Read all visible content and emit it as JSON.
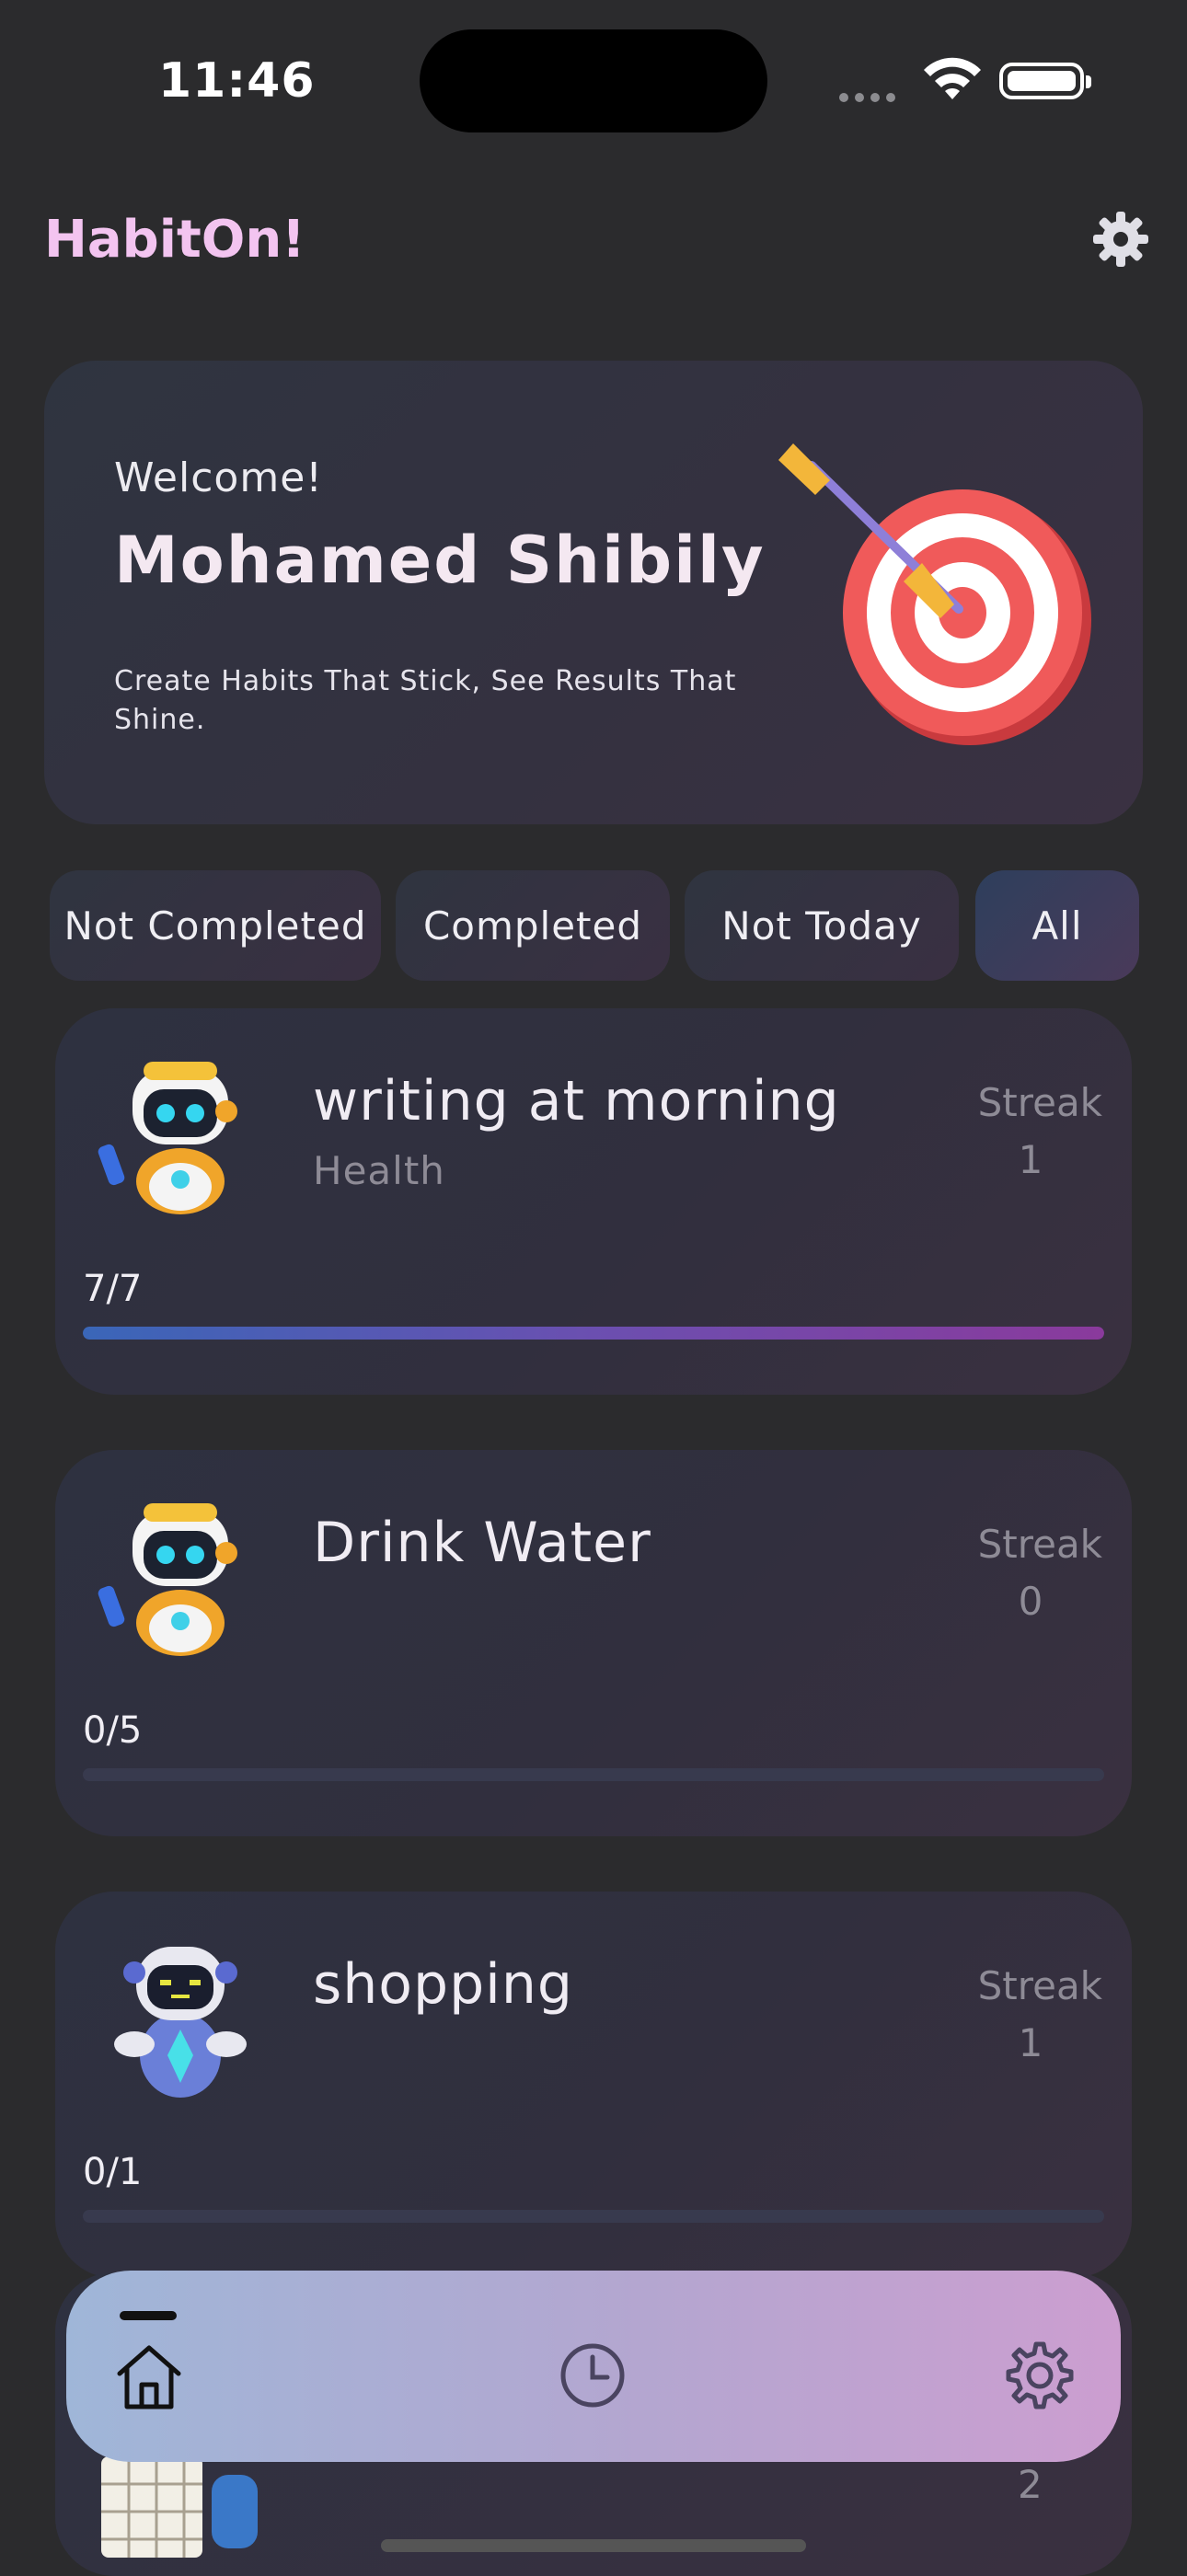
{
  "status": {
    "time": "11:46"
  },
  "app": {
    "title": "HabitOn!"
  },
  "welcome": {
    "label": "Welcome!",
    "name": "Mohamed Shibily",
    "subtitle": "Create Habits That Stick, See Results That Shine."
  },
  "filters": [
    {
      "label": "Not Completed",
      "active": false
    },
    {
      "label": "Completed",
      "active": false
    },
    {
      "label": "Not Today",
      "active": false
    },
    {
      "label": "All",
      "active": true
    }
  ],
  "habits": [
    {
      "name": "writing at morning",
      "category": "Health",
      "streak_label": "Streak",
      "streak": "1",
      "progress_text": "7/7",
      "progress_fraction": 1.0
    },
    {
      "name": "Drink Water",
      "category": "",
      "streak_label": "Streak",
      "streak": "0",
      "progress_text": "0/5",
      "progress_fraction": 0.0
    },
    {
      "name": "shopping",
      "category": "",
      "streak_label": "Streak",
      "streak": "1",
      "progress_text": "0/1",
      "progress_fraction": 0.0
    }
  ],
  "partial_habit": {
    "streak": "2"
  },
  "nav": {
    "items": [
      {
        "icon": "home-icon",
        "active": true
      },
      {
        "icon": "history-clock-icon",
        "active": false
      },
      {
        "icon": "settings-gear-icon",
        "active": false
      }
    ]
  },
  "colors": {
    "background": "#2b2b2d",
    "title_accent": "#f3c4f0",
    "progress_start": "#3a66b8",
    "progress_end": "#8a3a9c"
  }
}
